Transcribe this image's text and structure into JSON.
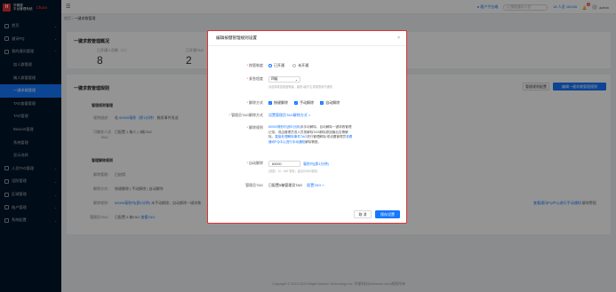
{
  "app": {
    "brand_cn_line1": "华基建",
    "brand_cn_line2": "平台管理系统",
    "brand_en": "Chuto"
  },
  "sidebar": {
    "items": [
      {
        "label": "首页",
        "icon": "home-icon",
        "arrow": "⌄",
        "sub": false,
        "active": false
      },
      {
        "label": "通讯PQ",
        "icon": "message-icon",
        "arrow": "⌄",
        "sub": false,
        "active": false
      },
      {
        "label": "我的通讯管理",
        "icon": "phone-icon",
        "arrow": "⌃",
        "sub": false,
        "active": false
      },
      {
        "label": "加人群管理",
        "icon": "",
        "arrow": "",
        "sub": true,
        "active": false
      },
      {
        "label": "踢人群管管理",
        "icon": "",
        "arrow": "",
        "sub": true,
        "active": false
      },
      {
        "label": "一键求救管理",
        "icon": "",
        "arrow": "",
        "sub": true,
        "active": true
      },
      {
        "label": "TAG查看管理",
        "icon": "",
        "arrow": "",
        "sub": true,
        "active": false
      },
      {
        "label": "TAG管理",
        "icon": "",
        "arrow": "",
        "sub": true,
        "active": false
      },
      {
        "label": "Beacon管理",
        "icon": "",
        "arrow": "",
        "sub": true,
        "active": false
      },
      {
        "label": "系统管理",
        "icon": "",
        "arrow": "",
        "sub": true,
        "active": false
      },
      {
        "label": "显示选择",
        "icon": "",
        "arrow": "",
        "sub": true,
        "active": false
      },
      {
        "label": "人员TAG管理",
        "icon": "user-icon",
        "arrow": "⌄",
        "sub": false,
        "active": false
      },
      {
        "label": "设防管理",
        "icon": "shield-icon",
        "arrow": "⌄",
        "sub": false,
        "active": false
      },
      {
        "label": "区域管理",
        "icon": "area-icon",
        "arrow": "⌄",
        "sub": false,
        "active": false
      },
      {
        "label": "账户管理",
        "icon": "account-icon",
        "arrow": "⌄",
        "sub": false,
        "active": false
      },
      {
        "label": "系统配置",
        "icon": "gear-icon",
        "arrow": "⌄",
        "sub": false,
        "active": false
      }
    ]
  },
  "header": {
    "menu_icon": "☰",
    "help_label": "客户平台端",
    "search_placeholder": "Q 按照通讯人员",
    "online_label": "18 人员 18/165",
    "bell_count": "9",
    "user_name": "admin"
  },
  "breadcrumb": {
    "root": "首页",
    "sep": "/",
    "current": "一键求救管理"
  },
  "overview": {
    "title": "一键求救管理概况",
    "stats": [
      {
        "label": "已开通人员数（人）",
        "value": "8"
      },
      {
        "label": "已开通TAG",
        "value": "2"
      }
    ]
  },
  "rules": {
    "title": "一键求救管理规则",
    "btn_settings": "管理规则配置",
    "btn_primary": "编辑一键求救管理规则",
    "section1": "管理规则管理",
    "rows1": [
      {
        "label": "规则描述：",
        "prefix": "若",
        "link": "60000毫秒（即1分钟）",
        "suffix": "触发事件发送"
      },
      {
        "label": "可触发人员TAG：",
        "prefix": "",
        "link": "",
        "suffix": "已配置 1 箱人 | 3箱TAG"
      }
    ],
    "section2": "管理解除规则",
    "rows2": [
      {
        "label": "解除管理：",
        "prefix": "",
        "link": "",
        "suffix": "已启用"
      },
      {
        "label": "解除方式：",
        "prefix": "",
        "link": "",
        "suffix": "按键解除 | 手动解除 | 自动解除"
      },
      {
        "label": "解除规则：",
        "prefix": "",
        "link": "60000毫秒内(即1分钟)",
        "suffix": "未手动解除，自动解除一键求救"
      },
      {
        "label": "管理员TAG：",
        "prefix": "",
        "link": "查看TAG",
        "suffix": "已配置 5 箱TAG"
      }
    ],
    "right_link": "查看通讯PQ中心进行手动通知",
    "right_suffix": "解除警报"
  },
  "modal": {
    "title": "编辑按键管理规则设置",
    "close": "×",
    "manage_label": "按管制度",
    "manage_options": [
      "已开通",
      "未开通"
    ],
    "level_label": "紧急程度",
    "level_value": "四级",
    "level_hint": "请选择紧急程度等级，级别1级不生成报表则不通知",
    "release_label": "解除方式",
    "release_options": [
      "按键解除",
      "手动解除",
      "自动解除"
    ],
    "tag_label": "管理员TAG解除方式",
    "tag_link": "设置管理员TAG解除方式 >",
    "rule_label": "解除规则",
    "rule_text_1": "60000毫秒内(即1分钟)",
    "rule_text_2": "未手动解除，自动解除一键求救管理记录。或由管理员或人员按解除TAG解除原因最后告警解除。",
    "rule_text_3": "直接处理解除事件TAG",
    "rule_text_4": "进行管理解除/或设置管理员",
    "rule_text_5": "查看通讯PQ中心进行手动通知",
    "rule_text_6": "解除警报。",
    "auto_label": "自动解除",
    "auto_value": "60000",
    "auto_link": "毫秒内(即1分钟)",
    "auto_hint": "(范围：10 - 600 毫秒；建议60000毫秒)",
    "admin_tag_label": "管理员TAG",
    "admin_tag_value": "已配置5箱管理员TAG",
    "admin_tag_link": "配置TAG >",
    "cancel": "取 消",
    "save": "保存设置"
  },
  "footer": {
    "text": "Copyright © 2019-2024 Bright Beacon Technology Inc. 华基科技(Brbeacon.com)版权所有"
  },
  "colors": {
    "primary": "#1677ff",
    "highlight_border": "#e03131",
    "sidebar_bg": "#001529"
  }
}
